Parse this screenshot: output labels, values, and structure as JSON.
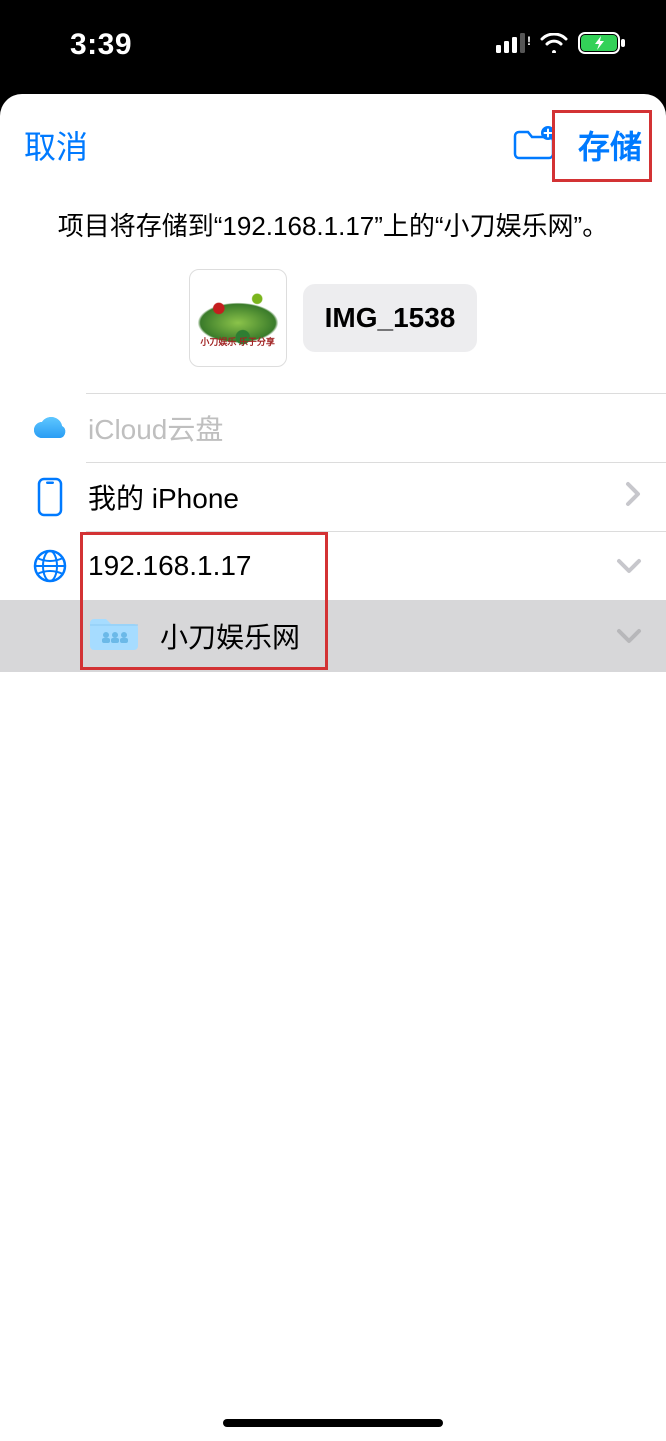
{
  "status": {
    "time": "3:39"
  },
  "nav": {
    "cancel": "取消",
    "save": "存储"
  },
  "subtitle": "项目将存储到“192.168.1.17”上的“小刀娱乐网”。",
  "file": {
    "name": "IMG_1538"
  },
  "locations": {
    "icloud": "iCloud云盘",
    "my_iphone": "我的 iPhone",
    "server": "192.168.1.17",
    "selected_folder": "小刀娱乐网"
  }
}
